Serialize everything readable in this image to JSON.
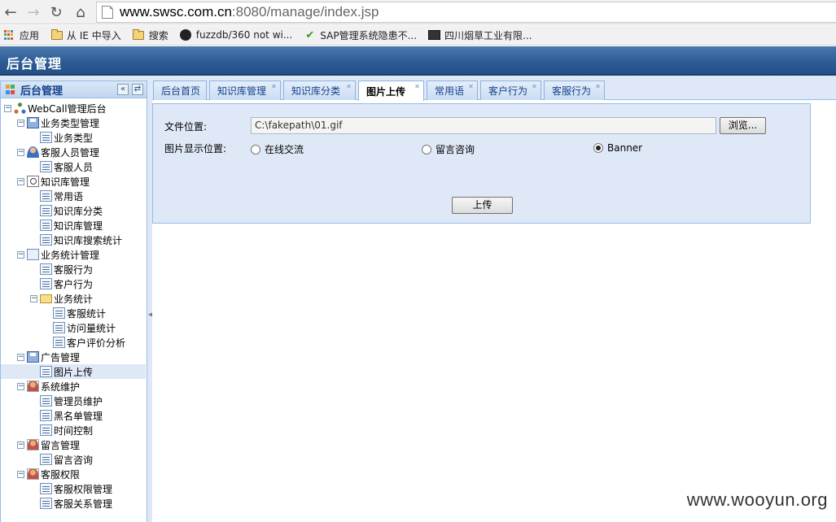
{
  "browser": {
    "url_host": "www.swsc.com.cn",
    "url_rest": ":8080/manage/index.jsp",
    "bookmarks": [
      {
        "label": "应用",
        "icon": "apps-icon"
      },
      {
        "label": "从 IE 中导入",
        "icon": "folder-icon"
      },
      {
        "label": "搜索",
        "icon": "folder-icon"
      },
      {
        "label": "fuzzdb/360 not wi...",
        "icon": "github-icon"
      },
      {
        "label": "SAP管理系统隐患不...",
        "icon": "check-icon"
      },
      {
        "label": "四川烟草工业有限...",
        "icon": "picture-icon"
      }
    ]
  },
  "header": {
    "title": "后台管理"
  },
  "sidebar": {
    "title": "后台管理",
    "tree": [
      {
        "label": "WebCall管理后台",
        "level": 0,
        "icon": "root"
      },
      {
        "label": "业务类型管理",
        "level": 1,
        "icon": "disk"
      },
      {
        "label": "业务类型",
        "level": 2,
        "icon": "leaf"
      },
      {
        "label": "客服人员管理",
        "level": 1,
        "icon": "user"
      },
      {
        "label": "客服人员",
        "level": 2,
        "icon": "leaf"
      },
      {
        "label": "知识库管理",
        "level": 1,
        "icon": "search"
      },
      {
        "label": "常用语",
        "level": 2,
        "icon": "leaf"
      },
      {
        "label": "知识库分类",
        "level": 2,
        "icon": "leaf"
      },
      {
        "label": "知识库管理",
        "level": 2,
        "icon": "leaf"
      },
      {
        "label": "知识库搜索统计",
        "level": 2,
        "icon": "leaf"
      },
      {
        "label": "业务统计管理",
        "level": 1,
        "icon": "doc"
      },
      {
        "label": "客服行为",
        "level": 2,
        "icon": "leaf"
      },
      {
        "label": "客户行为",
        "level": 2,
        "icon": "leaf"
      },
      {
        "label": "业务统计",
        "level": 2,
        "icon": "folder"
      },
      {
        "label": "客服统计",
        "level": 3,
        "icon": "leaf"
      },
      {
        "label": "访问量统计",
        "level": 3,
        "icon": "leaf"
      },
      {
        "label": "客户评价分析",
        "level": 3,
        "icon": "leaf"
      },
      {
        "label": "广告管理",
        "level": 1,
        "icon": "disk"
      },
      {
        "label": "图片上传",
        "level": 2,
        "icon": "leaf",
        "selected": true
      },
      {
        "label": "系统维护",
        "level": 1,
        "icon": "person"
      },
      {
        "label": "管理员维护",
        "level": 2,
        "icon": "leaf"
      },
      {
        "label": "黑名单管理",
        "level": 2,
        "icon": "leaf"
      },
      {
        "label": "时间控制",
        "level": 2,
        "icon": "leaf"
      },
      {
        "label": "留言管理",
        "level": 1,
        "icon": "person"
      },
      {
        "label": "留言咨询",
        "level": 2,
        "icon": "leaf"
      },
      {
        "label": "客服权限",
        "level": 1,
        "icon": "person"
      },
      {
        "label": "客服权限管理",
        "level": 2,
        "icon": "leaf"
      },
      {
        "label": "客服关系管理",
        "level": 2,
        "icon": "leaf"
      }
    ]
  },
  "tabs": [
    {
      "label": "后台首页",
      "closable": false
    },
    {
      "label": "知识库管理",
      "closable": true
    },
    {
      "label": "知识库分类",
      "closable": true
    },
    {
      "label": "图片上传",
      "closable": true,
      "active": true
    },
    {
      "label": "常用语",
      "closable": true
    },
    {
      "label": "客户行为",
      "closable": true
    },
    {
      "label": "客服行为",
      "closable": true
    }
  ],
  "form": {
    "file_label": "文件位置:",
    "file_value": "C:\\fakepath\\01.gif",
    "browse_label": "浏览...",
    "position_label": "图片显示位置:",
    "options": [
      {
        "label": "在线交流",
        "checked": false
      },
      {
        "label": "留言咨询",
        "checked": false
      },
      {
        "label": "Banner",
        "checked": true
      }
    ],
    "upload_label": "上传"
  },
  "watermark": "www.wooyun.org"
}
